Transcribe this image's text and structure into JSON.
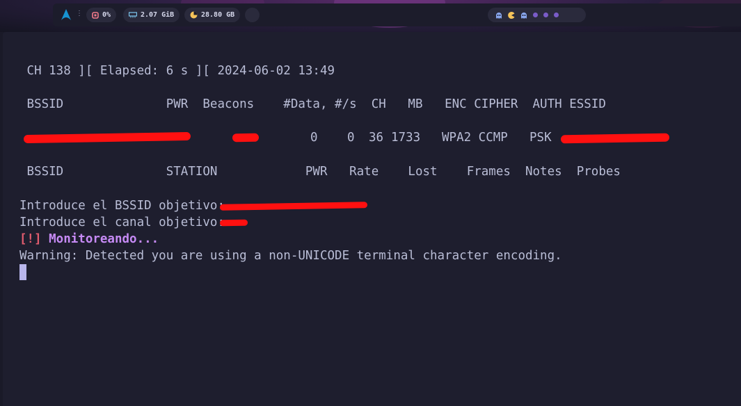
{
  "topbar": {
    "cpu": "0%",
    "memory": "2.07 GiB",
    "disk": "28.80 GB",
    "icons": [
      "arch-logo-icon",
      "menu-dots-icon",
      "cpu-icon",
      "memory-icon",
      "disk-pie-icon",
      "ghost-icon",
      "pacman-icon",
      "ghost-icon"
    ],
    "workspaces_count": 7
  },
  "terminal": {
    "status": " CH 138 ][ Elapsed: 6 s ][ 2024-06-02 13:49",
    "ap_header": " BSSID              PWR  Beacons    #Data, #/s  CH   MB   ENC CIPHER  AUTH ESSID",
    "ap_row": {
      "data": "0",
      "per_sec": "0",
      "ch": "36",
      "mb": "1733",
      "enc_cipher": "WPA2 CCMP",
      "auth": "PSK"
    },
    "station_header": " BSSID              STATION            PWR   Rate    Lost    Frames  Notes  Probes",
    "prompt_bssid": "Introduce el BSSID objetivo: ",
    "prompt_channel": "Introduce el canal objetivo: ",
    "alert_tag": "[!]",
    "alert_text": " Monitoreando...",
    "warning": "Warning: Detected you are using a non-UNICODE terminal character encoding."
  },
  "colors": {
    "terminal_bg": "#1e1e2e",
    "terminal_fg": "#b9bdd6",
    "alert_tag": "#e05c6e",
    "alert_text": "#c68af5",
    "redaction": "#ff1010",
    "workspace_dot": "#7a5cc8"
  }
}
